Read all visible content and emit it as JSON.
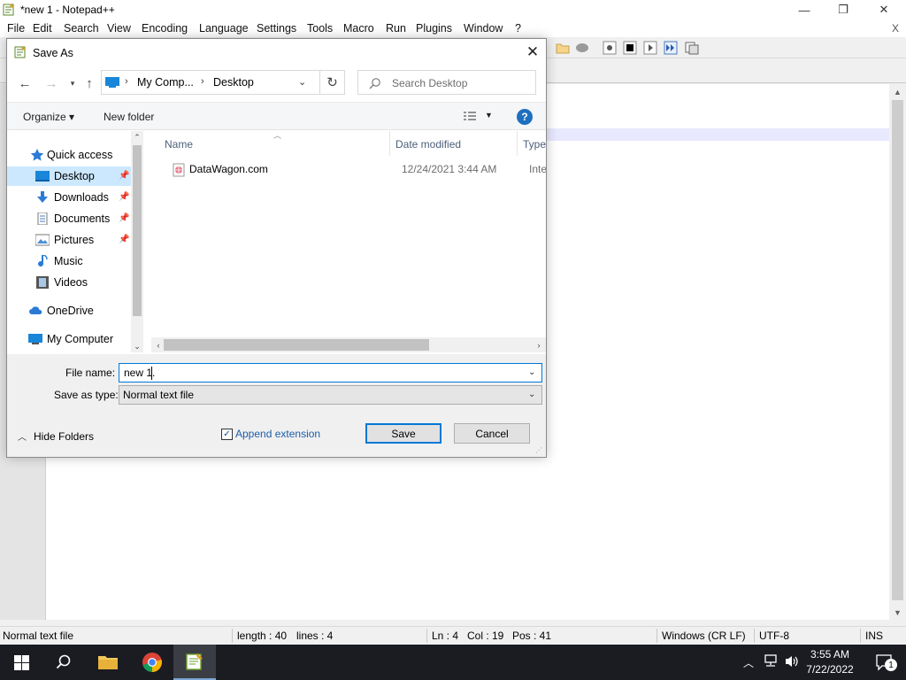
{
  "app": {
    "title": "*new 1 - Notepad++",
    "menu": [
      "File",
      "Edit",
      "Search",
      "View",
      "Encoding",
      "Language",
      "Settings",
      "Tools",
      "Macro",
      "Run",
      "Plugins",
      "Window",
      "?"
    ],
    "doc_close": "X",
    "window_buttons": {
      "minimize": "—",
      "restore": "❐",
      "close": "✕"
    }
  },
  "statusbar": {
    "type": "Normal text file",
    "length": "length : 40",
    "lines": "lines : 4",
    "ln": "Ln : 4",
    "col": "Col : 19",
    "pos": "Pos : 41",
    "eol": "Windows (CR LF)",
    "encoding": "UTF-8",
    "mode": "INS"
  },
  "dialog": {
    "title": "Save As",
    "close": "✕",
    "address": {
      "crumbs": [
        "My Comp...",
        "Desktop"
      ]
    },
    "search_placeholder": "Search Desktop",
    "commands": {
      "organize": "Organize ▾",
      "new_folder": "New folder",
      "help": "?"
    },
    "nav_items": [
      {
        "label": "Quick access",
        "icon": "star-icon"
      },
      {
        "label": "Desktop",
        "icon": "desktop-icon",
        "pinned": true,
        "selected": true
      },
      {
        "label": "Downloads",
        "icon": "download-icon",
        "pinned": true
      },
      {
        "label": "Documents",
        "icon": "documents-icon",
        "pinned": true
      },
      {
        "label": "Pictures",
        "icon": "pictures-icon",
        "pinned": true
      },
      {
        "label": "Music",
        "icon": "music-icon"
      },
      {
        "label": "Videos",
        "icon": "videos-icon"
      },
      {
        "label": "OneDrive",
        "icon": "cloud-icon"
      },
      {
        "label": "My Computer",
        "icon": "computer-icon"
      }
    ],
    "columns": {
      "name": "Name",
      "date": "Date modified",
      "type": "Type"
    },
    "files": [
      {
        "name": "DataWagon.com",
        "date": "12/24/2021 3:44 AM",
        "type": "Intern"
      }
    ],
    "file_name_label": "File name:",
    "file_name_value": "new 1.",
    "save_type_label": "Save as type:",
    "save_type_value": "Normal text file",
    "hide_folders": "Hide Folders",
    "append_extension": "Append extension",
    "append_checked": true,
    "save_button": "Save",
    "cancel_button": "Cancel"
  },
  "taskbar": {
    "time": "3:55 AM",
    "date": "7/22/2022",
    "notifications": "1"
  }
}
